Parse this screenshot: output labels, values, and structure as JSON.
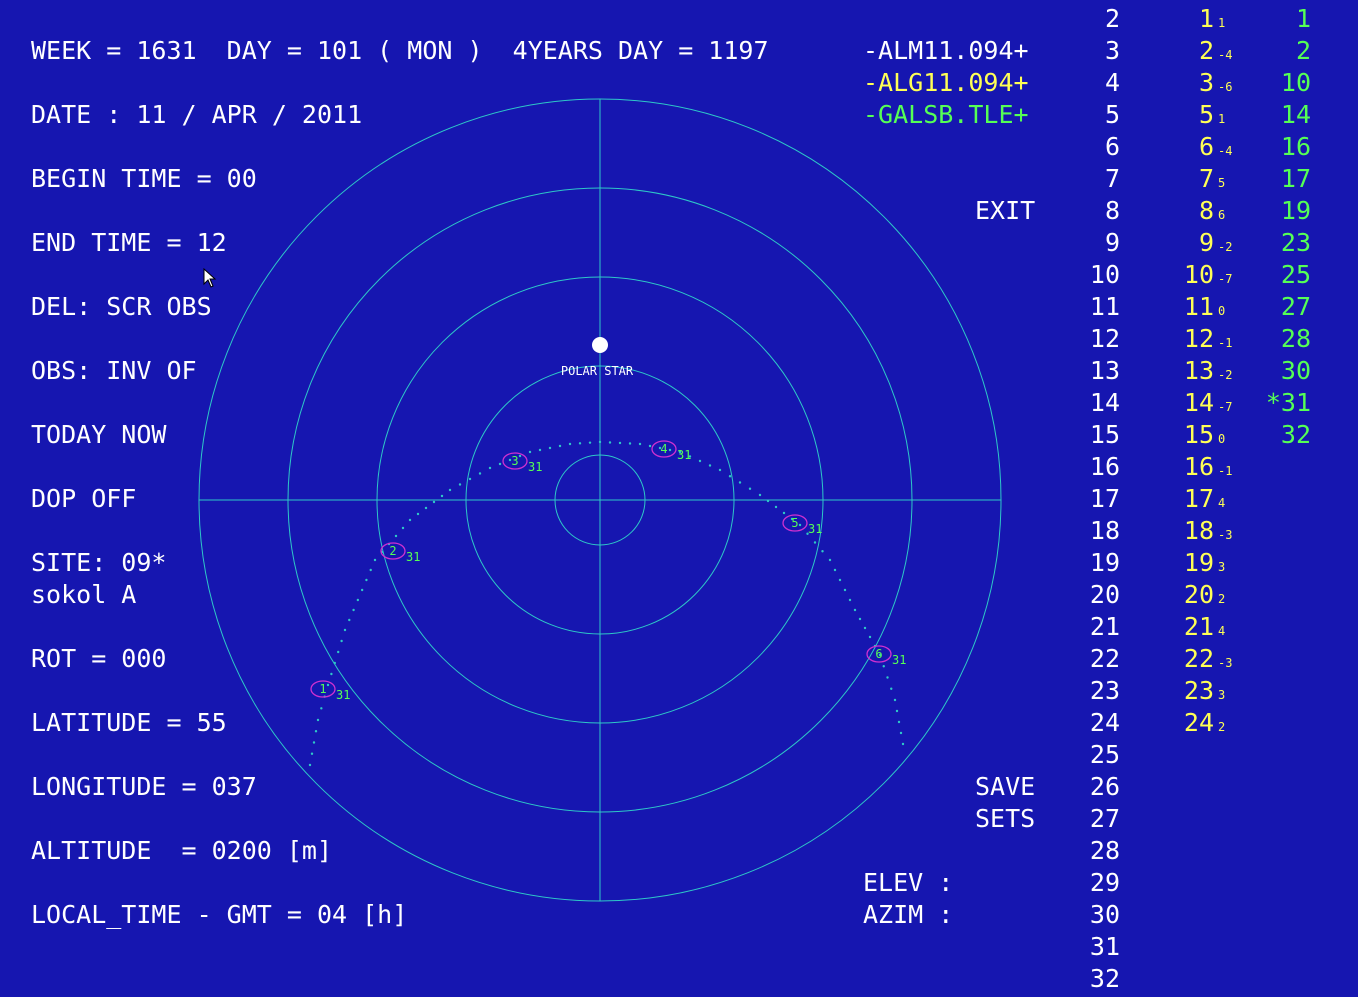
{
  "header": {
    "week_line": "WEEK = 1631  DAY = 101 ( MON )  4YEARS DAY = 1197",
    "date_line": "DATE : 11 / APR / 2011"
  },
  "params": {
    "begin_time": "BEGIN TIME = 00",
    "end_time": "END TIME = 12",
    "del": "DEL: SCR OBS",
    "obs": "OBS: INV OF",
    "today": "TODAY NOW",
    "dop": "DOP OFF",
    "site": "SITE: 09*",
    "site_name": "sokol A",
    "rot": "ROT = 000",
    "latitude": "LATITUDE = 55",
    "longitude": "LONGITUDE = 037",
    "altitude": "ALTITUDE  = 0200 [m]",
    "local_time": "LOCAL_TIME - GMT = 04 [h]"
  },
  "files": {
    "alm": "-ALM11.094+",
    "alg": "-ALG11.094+",
    "gal": "-GALSB.TLE+"
  },
  "buttons": {
    "exit": "EXIT",
    "save": "SAVE",
    "sets": "SETS"
  },
  "readout": {
    "elev": "ELEV :",
    "azim": "AZIM :"
  },
  "polar_star_label": "POLAR STAR",
  "sky_sats": [
    {
      "id": "1",
      "sub": "31"
    },
    {
      "id": "2",
      "sub": "31"
    },
    {
      "id": "3",
      "sub": "31"
    },
    {
      "id": "4",
      "sub": "31"
    },
    {
      "id": "5",
      "sub": "31"
    },
    {
      "id": "6",
      "sub": "31"
    }
  ],
  "col_white": [
    "2",
    "3",
    "4",
    "5",
    "6",
    "7",
    "8",
    "9",
    "10",
    "11",
    "12",
    "13",
    "14",
    "15",
    "16",
    "17",
    "18",
    "19",
    "20",
    "21",
    "22",
    "23",
    "24",
    "25",
    "26",
    "27",
    "28",
    "29",
    "30",
    "31",
    "32"
  ],
  "col_yellow": [
    {
      "n": "1",
      "s": "1"
    },
    {
      "n": "2",
      "s": "-4"
    },
    {
      "n": "3",
      "s": "-6"
    },
    {
      "n": "5",
      "s": "1"
    },
    {
      "n": "6",
      "s": "-4"
    },
    {
      "n": "7",
      "s": "5"
    },
    {
      "n": "8",
      "s": "6"
    },
    {
      "n": "9",
      "s": "-2"
    },
    {
      "n": "10",
      "s": "-7"
    },
    {
      "n": "11",
      "s": "0"
    },
    {
      "n": "12",
      "s": "-1"
    },
    {
      "n": "13",
      "s": "-2"
    },
    {
      "n": "14",
      "s": "-7"
    },
    {
      "n": "15",
      "s": "0"
    },
    {
      "n": "16",
      "s": "-1"
    },
    {
      "n": "17",
      "s": "4"
    },
    {
      "n": "18",
      "s": "-3"
    },
    {
      "n": "19",
      "s": "3"
    },
    {
      "n": "20",
      "s": "2"
    },
    {
      "n": "21",
      "s": "4"
    },
    {
      "n": "22",
      "s": "-3"
    },
    {
      "n": "23",
      "s": "3"
    },
    {
      "n": "24",
      "s": "2"
    }
  ],
  "col_green": [
    "1",
    "2",
    "10",
    "14",
    "16",
    "17",
    "19",
    "23",
    "25",
    "27",
    "28",
    "30",
    "*31",
    "32"
  ],
  "colors": {
    "background": "#1616b0",
    "grid": "#2ec8c8",
    "marker": "#d030d0",
    "yellow": "#ffff55",
    "green": "#55ff55"
  }
}
